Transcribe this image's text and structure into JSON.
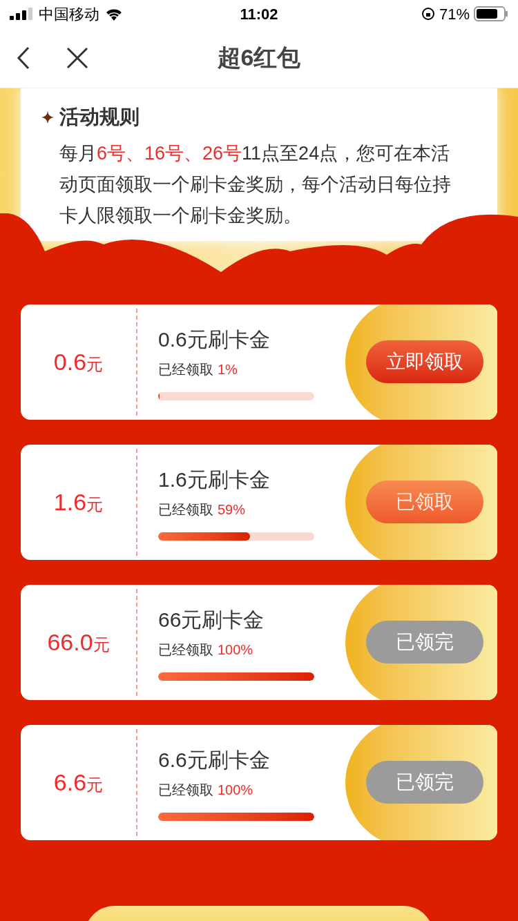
{
  "status_bar": {
    "carrier": "中国移动",
    "time": "11:02",
    "battery": "71%"
  },
  "nav": {
    "title": "超6红包"
  },
  "rules": {
    "title": "活动规则",
    "segments": [
      {
        "text": "每月",
        "highlight": false
      },
      {
        "text": "6号、16号、26号",
        "highlight": true
      },
      {
        "text": "11点至24点，您可在本活动页面领取一个刷卡金奖励，每个活动日每位持卡人限领取一个刷卡金奖励。",
        "highlight": false
      }
    ]
  },
  "rewards": [
    {
      "amount": "0.6",
      "unit": "元",
      "name": "0.6元刷卡金",
      "progress_label": "已经领取",
      "progress_value": "1%",
      "level": 0.01,
      "button": {
        "label": "立即领取",
        "kind": "claim"
      }
    },
    {
      "amount": "1.6",
      "unit": "元",
      "name": "1.6元刷卡金",
      "progress_label": "已经领取",
      "progress_value": "59%",
      "level": 0.59,
      "button": {
        "label": "已领取",
        "kind": "claimed"
      }
    },
    {
      "amount": "66.0",
      "unit": "元",
      "name": "66元刷卡金",
      "progress_label": "已经领取",
      "progress_value": "100%",
      "level": 1,
      "button": {
        "label": "已领完",
        "kind": "sold_out"
      }
    },
    {
      "amount": "6.6",
      "unit": "元",
      "name": "6.6元刷卡金",
      "progress_label": "已经领取",
      "progress_value": "100%",
      "level": 1,
      "button": {
        "label": "已领完",
        "kind": "sold_out"
      }
    }
  ]
}
